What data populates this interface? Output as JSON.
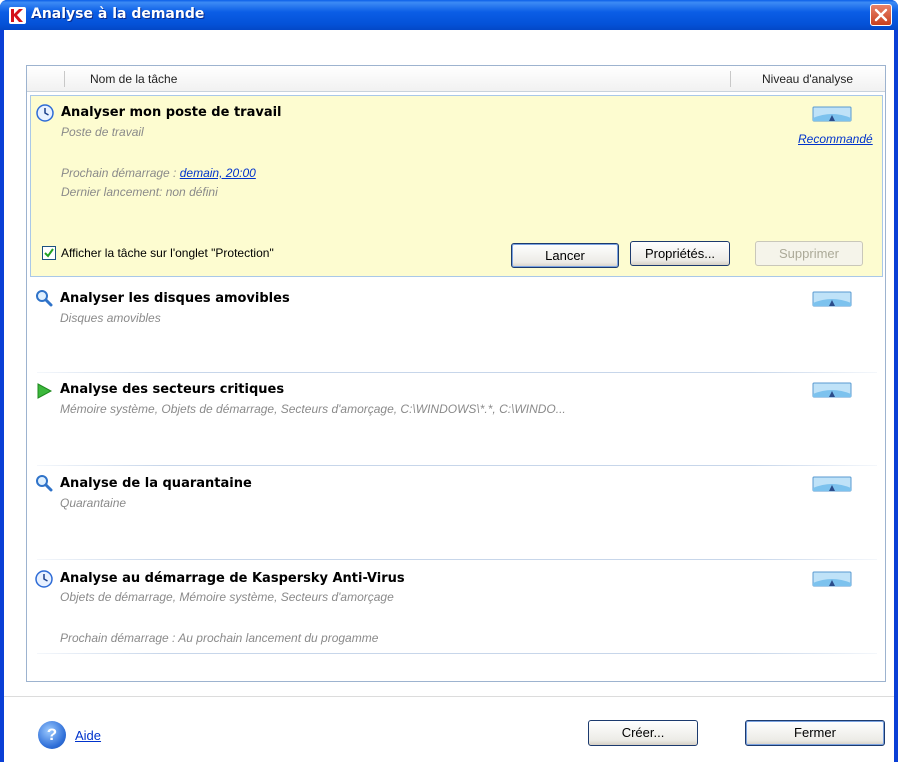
{
  "window": {
    "title": "Analyse à la demande"
  },
  "columns": {
    "name": "Nom de la tâche",
    "level": "Niveau d'analyse"
  },
  "tasks": [
    {
      "title": "Analyser mon poste de travail",
      "subtitle": "Poste de travail",
      "next_start_label": "Prochain démarrage :",
      "next_start_value": "demain, 20:00",
      "last_run": "Dernier lancement: non défini",
      "level_label": "Recommandé",
      "icon": "clock-icon",
      "show_on_tab": {
        "label": "Afficher la tâche sur l'onglet \"Protection\"",
        "checked": true
      },
      "buttons": {
        "run": "Lancer",
        "properties": "Propriétés...",
        "delete": "Supprimer"
      }
    },
    {
      "title": "Analyser les disques amovibles",
      "subtitle": "Disques amovibles",
      "icon": "magnifier-icon"
    },
    {
      "title": "Analyse des secteurs critiques",
      "subtitle": "Mémoire système, Objets de démarrage, Secteurs d'amorçage, C:\\WINDOWS\\*.*, C:\\WINDO...",
      "icon": "play-icon"
    },
    {
      "title": "Analyse de la quarantaine",
      "subtitle": "Quarantaine",
      "icon": "magnifier-icon"
    },
    {
      "title": "Analyse au démarrage de Kaspersky Anti-Virus",
      "subtitle": "Objets de démarrage, Mémoire système, Secteurs d'amorçage",
      "next_start": "Prochain démarrage : Au prochain lancement du progamme",
      "icon": "clock-icon"
    }
  ],
  "footer": {
    "help": "Aide",
    "create": "Créer...",
    "close": "Fermer"
  },
  "colors": {
    "titlebar": "#0452d8",
    "selected_row": "#fdfcd0",
    "link": "#0033cc"
  }
}
